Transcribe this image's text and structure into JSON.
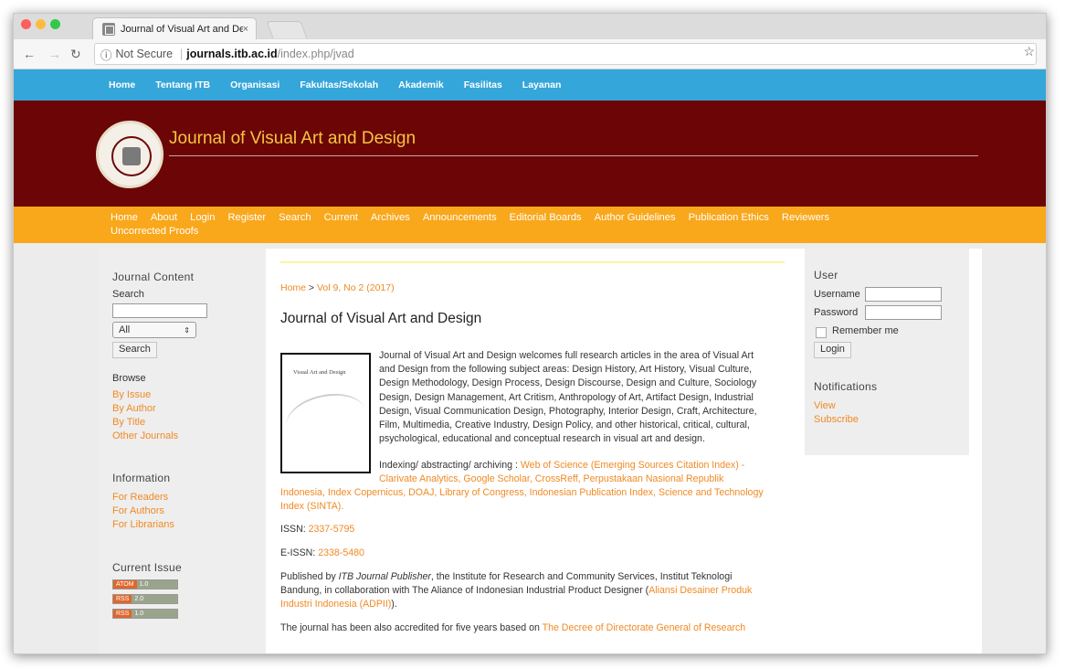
{
  "browser": {
    "tab_title": "Journal of Visual Art and Desig",
    "tab_close": "×",
    "not_secure": "Not Secure",
    "url_host": "journals.itb.ac.id",
    "url_path": "/index.php/jvad",
    "colors": {
      "close": "#fc605c",
      "minimize": "#fdbc40",
      "zoom": "#34c84a"
    }
  },
  "topnav": [
    "Home",
    "Tentang ITB",
    "Organisasi",
    "Fakultas/Sekolah",
    "Akademik",
    "Fasilitas",
    "Layanan"
  ],
  "banner": {
    "title": "Journal of Visual Art and Design"
  },
  "mainnav": [
    "Home",
    "About",
    "Login",
    "Register",
    "Search",
    "Current",
    "Archives",
    "Announcements",
    "Editorial Boards",
    "Author Guidelines",
    "Publication Ethics",
    "Reviewers",
    "Uncorrected Proofs"
  ],
  "left_sidebar": {
    "journal_content_title": "Journal Content",
    "search_label": "Search",
    "search_value": "",
    "scope_selected": "All",
    "search_button": "Search",
    "browse_title": "Browse",
    "browse_links": [
      "By Issue",
      "By Author",
      "By Title",
      "Other Journals"
    ],
    "information_title": "Information",
    "information_links": [
      "For Readers",
      "For Authors",
      "For Librarians"
    ],
    "current_issue_title": "Current Issue",
    "feeds": [
      {
        "kind": "ATOM",
        "version": "1.0"
      },
      {
        "kind": "RSS",
        "version": "2.0"
      },
      {
        "kind": "RSS",
        "version": "1.0"
      }
    ]
  },
  "main": {
    "breadcrumb_home": "Home",
    "breadcrumb_sep": " > ",
    "breadcrumb_issue": "Vol 9, No 2 (2017)",
    "title": "Journal of Visual Art and Design",
    "cover_title": "Visual Art and Design",
    "description_lines": [
      "Journal of Visual Art and Design welcomes full research articles in the area of Visual Art",
      "and Design from the following subject areas: Design History, Art History, Visual Culture,",
      "Design Methodology, Design Process, Design Discourse, Design and Culture, Sociology",
      "Design, Design Management, Art Critism, Anthropology of Art, Artifact Design, Industrial",
      "Design, Visual Communication Design, Photography, Interior Design, Craft, Architecture,",
      "Film, Multimedia, Creative Industry, Design Policy, and other historical, critical, cultural,",
      "psychological, educational and conceptual research in visual art and design."
    ],
    "indexing_label": "Indexing/ abstracting/ archiving : ",
    "indexing_line1": "Web of Science (Emerging Sources Citation Index) -",
    "indexing_line2": "Clarivate Analytics,  Google Scholar, CrossReff, Perpustakaan Nasional Republik",
    "indexing_line3": "Indonesia, Index Copernicus, DOAJ, Library of Congress, Indonesian Publication Index, Science and Technology",
    "indexing_line4": "Index (SINTA).",
    "issn_label": "ISSN: ",
    "issn": "2337-5795",
    "eissn_label": "E-ISSN: ",
    "eissn": "2338-5480",
    "published_prefix": "Published by ",
    "publisher": "ITB Journal Publisher",
    "published_rest1": ", the Institute for Research and Community Services, Institut Teknologi",
    "published_line2a": "Bandung, in collaboration with The Aliance of Indonesian Industrial Product Designer (",
    "published_line2b": "Aliansi Desainer Produk",
    "published_line3a": "Industri Indonesia (ADPII)",
    "published_line3b": ").",
    "accredited_text": "The journal has been also accredited for five years based on ",
    "accredited_link": "The Decree of Directorate General of Research"
  },
  "right_sidebar": {
    "user_title": "User",
    "username_label": "Username",
    "username_value": "",
    "password_label": "Password",
    "password_value": "",
    "remember_label": "Remember me",
    "login_button": "Login",
    "notifications_title": "Notifications",
    "notification_links": [
      "View",
      "Subscribe"
    ]
  }
}
